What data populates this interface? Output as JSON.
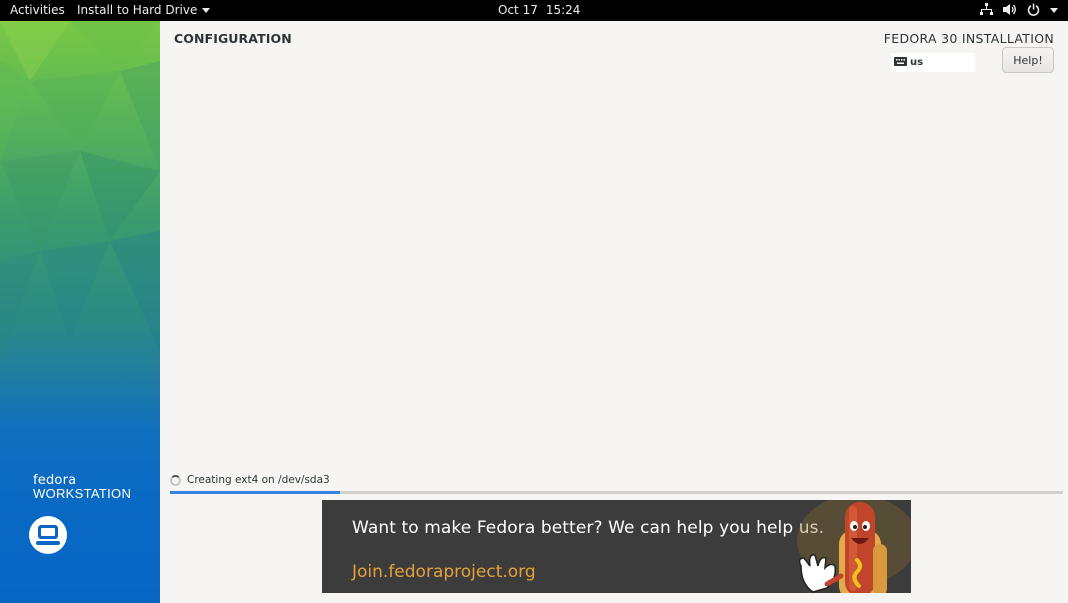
{
  "topbar": {
    "activities": "Activities",
    "app_menu": "Install to Hard Drive",
    "date": "Oct 17",
    "time": "15:24",
    "icons": [
      "network-icon",
      "volume-icon",
      "power-icon",
      "chevron-down-icon"
    ]
  },
  "sidebar": {
    "brand_name": "fedora",
    "brand_edition": "WORKSTATION",
    "logo_icon": "laptop-icon"
  },
  "header": {
    "title": "CONFIGURATION",
    "product_title": "FEDORA 30 INSTALLATION",
    "keyboard_layout": "us",
    "keyboard_icon": "keyboard-icon",
    "help_label": "Help!"
  },
  "progress": {
    "status_text": "Creating ext4 on /dev/sda3",
    "fraction": 0.19
  },
  "banner": {
    "headline": "Want to make Fedora better? We can help you help us.",
    "link": "Join.fedoraproject.org",
    "mascot": "hotdog-mascot"
  },
  "colors": {
    "accent": "#3584e4",
    "banner_bg": "#3c3c3c",
    "link": "#e8a13a",
    "sidebar_top": "#79c843",
    "sidebar_bottom": "#0766c4"
  }
}
